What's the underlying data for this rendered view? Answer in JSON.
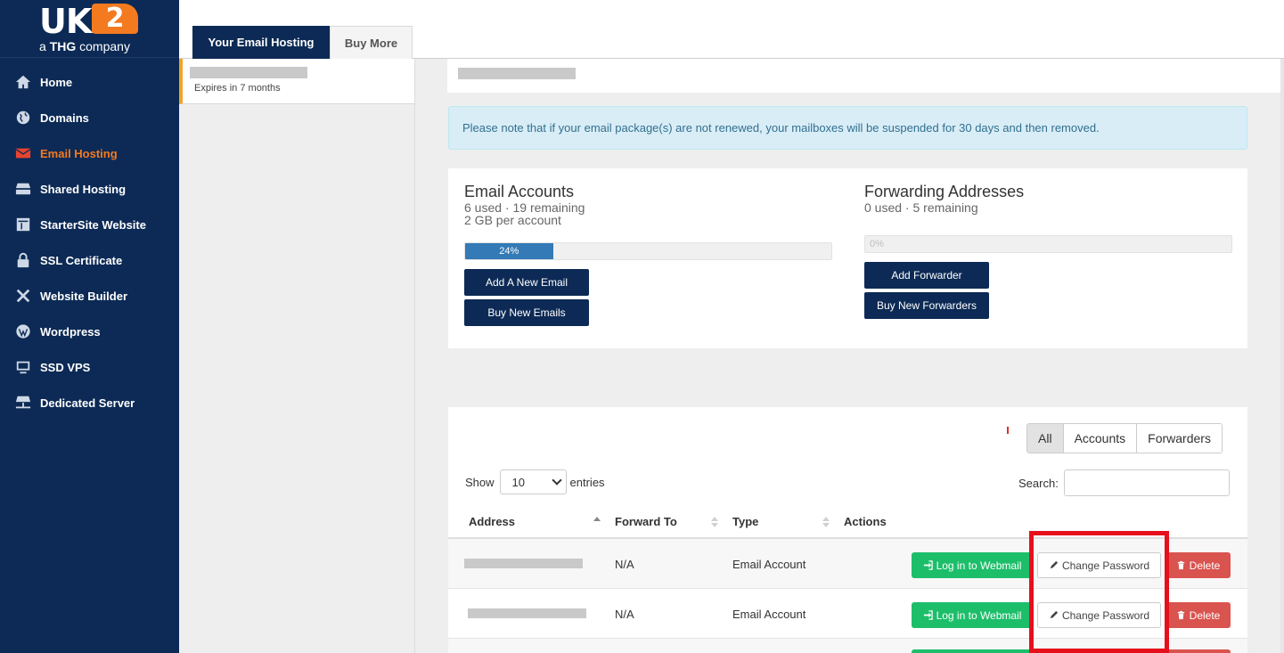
{
  "logo": {
    "text": "UK",
    "badge": "2",
    "tagline_a": "a ",
    "tagline_b": "THG",
    "tagline_c": " company"
  },
  "sidebar": {
    "items": [
      {
        "label": "Home",
        "icon": "home-icon"
      },
      {
        "label": "Domains",
        "icon": "globe-icon"
      },
      {
        "label": "Email Hosting",
        "icon": "envelope-icon",
        "active": true
      },
      {
        "label": "Shared Hosting",
        "icon": "server-stack-icon"
      },
      {
        "label": "StarterSite Website",
        "icon": "layout-icon"
      },
      {
        "label": "SSL Certificate",
        "icon": "lock-icon"
      },
      {
        "label": "Website Builder",
        "icon": "tools-icon"
      },
      {
        "label": "Wordpress",
        "icon": "wordpress-icon"
      },
      {
        "label": "SSD VPS",
        "icon": "monitor-icon"
      },
      {
        "label": "Dedicated Server",
        "icon": "network-server-icon"
      }
    ]
  },
  "tabs": {
    "active": "Your Email Hosting",
    "more": "Buy More"
  },
  "package": {
    "expires": "Expires in 7 months"
  },
  "notice": "Please note that if your email package(s) are not renewed, your mailboxes will be suspended for 30 days and then removed.",
  "email_accounts": {
    "title": "Email Accounts",
    "usage": "6 used · 19 remaining",
    "quota": "2 GB per account",
    "progress_label": "24%",
    "progress_fraction": 0.24,
    "add_button": "Add A New Email",
    "buy_button": "Buy New Emails"
  },
  "forwarding": {
    "title": "Forwarding Addresses",
    "usage": "0 used · 5 remaining",
    "progress_label": "0%",
    "progress_fraction": 0,
    "add_button": "Add Forwarder",
    "buy_button": "Buy New Forwarders"
  },
  "filters": {
    "all": "All",
    "accounts": "Accounts",
    "forwarders": "Forwarders"
  },
  "table_controls": {
    "show": "Show",
    "entries_value": "10",
    "entries": "entries",
    "search": "Search:"
  },
  "columns": {
    "address": "Address",
    "forward_to": "Forward To",
    "type": "Type",
    "actions": "Actions"
  },
  "rows": [
    {
      "forward_to": "N/A",
      "type": "Email Account"
    },
    {
      "forward_to": "N/A",
      "type": "Email Account"
    }
  ],
  "row_actions": {
    "webmail": "Log in to Webmail",
    "change_password": "Change Password",
    "delete": "Delete"
  },
  "colors": {
    "navy": "#0c2a55",
    "orange": "#f47a20",
    "green": "#1dbe6a",
    "red": "#d9534f",
    "highlight": "#e60f1c"
  }
}
